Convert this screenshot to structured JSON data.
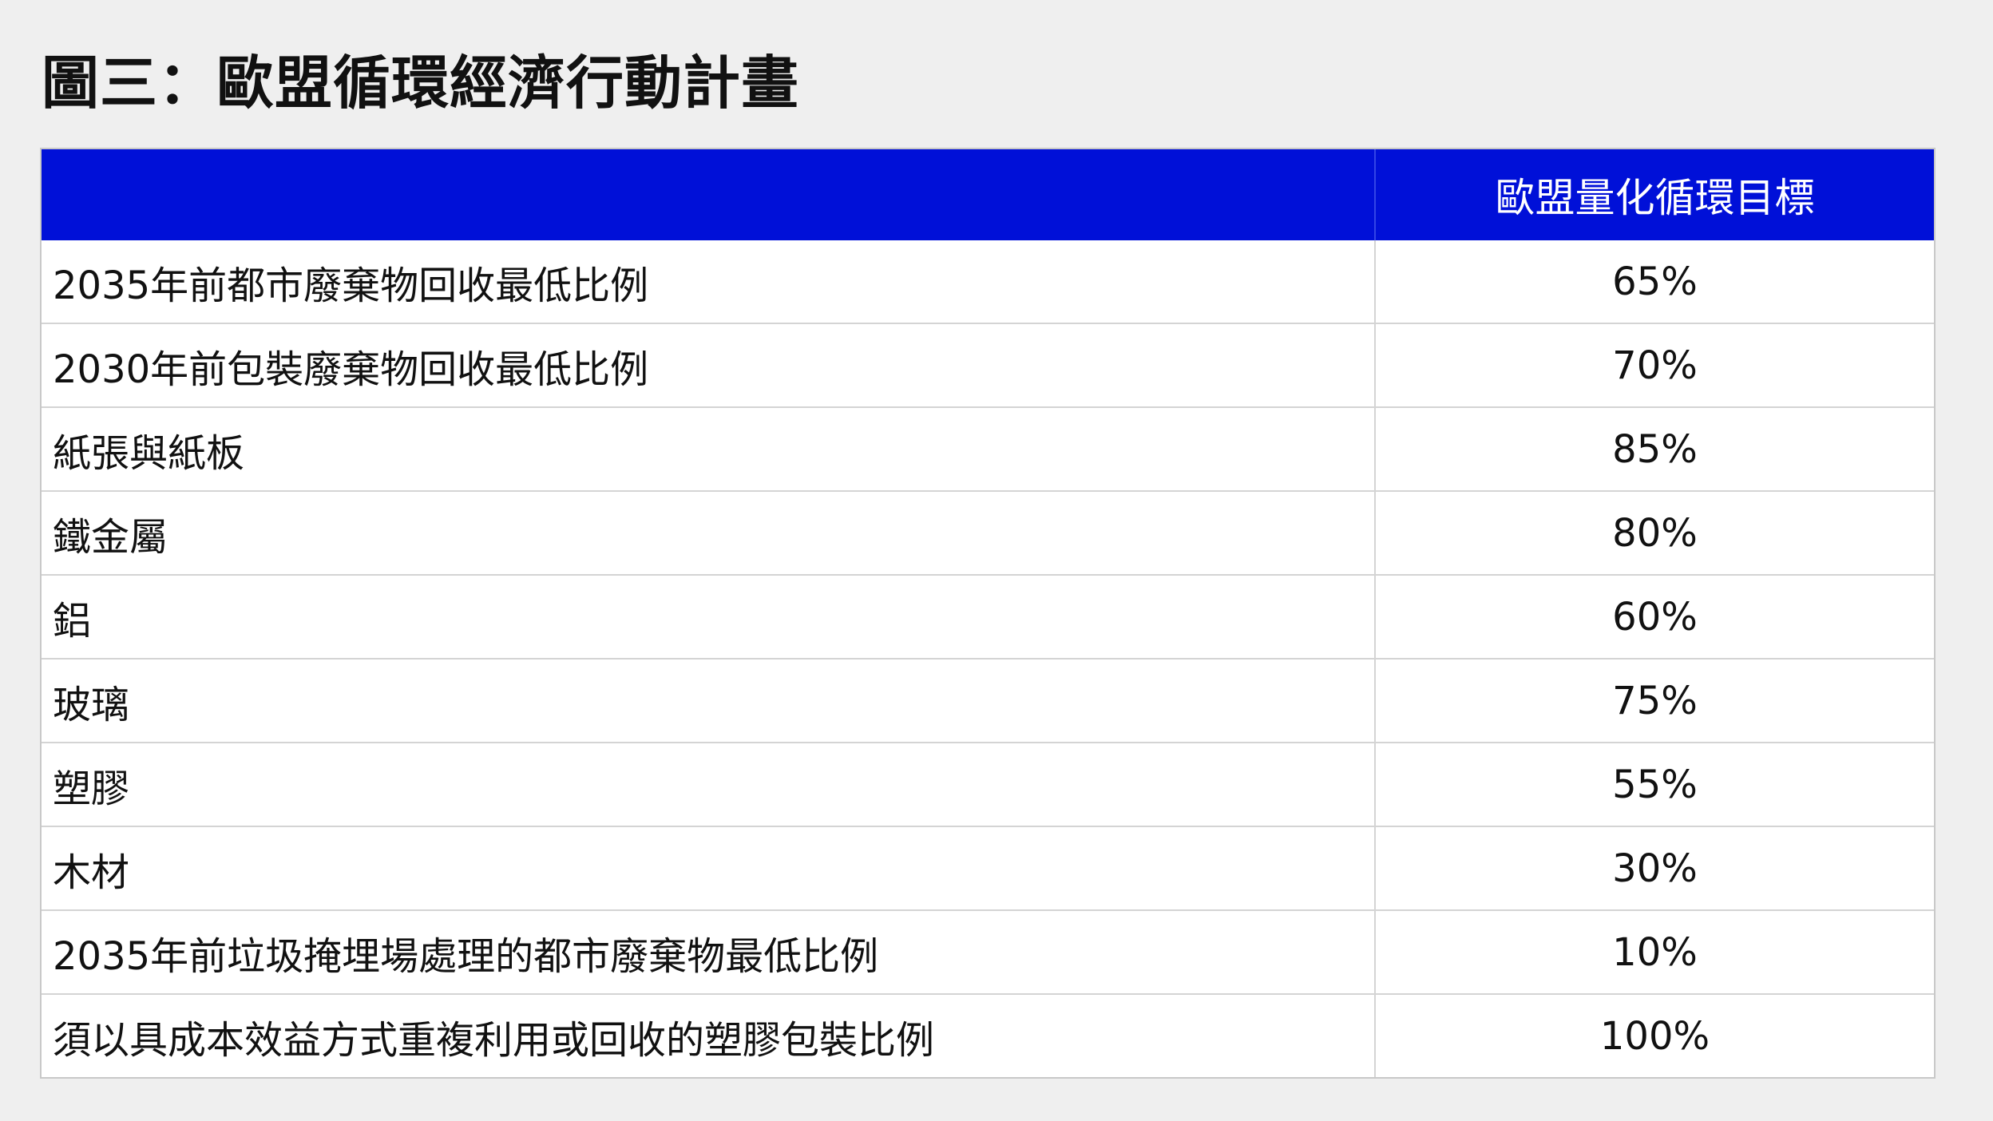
{
  "title": "圖三：歐盟循環經濟行動計畫",
  "colors": {
    "header_bg": "#0010d8",
    "header_text": "#ffffff",
    "page_bg": "#efefef"
  },
  "table": {
    "headers": [
      "",
      "歐盟量化循環目標"
    ],
    "rows": [
      {
        "label": "2035年前都市廢棄物回收最低比例",
        "value": "65%"
      },
      {
        "label": "2030年前包裝廢棄物回收最低比例",
        "value": "70%"
      },
      {
        "label": "紙張與紙板",
        "value": "85%"
      },
      {
        "label": "鐵金屬",
        "value": "80%"
      },
      {
        "label": "鋁",
        "value": "60%"
      },
      {
        "label": "玻璃",
        "value": "75%"
      },
      {
        "label": "塑膠",
        "value": "55%"
      },
      {
        "label": "木材",
        "value": "30%"
      },
      {
        "label": "2035年前垃圾掩埋場處理的都市廢棄物最低比例",
        "value": "10%"
      },
      {
        "label": "須以具成本效益方式重複利用或回收的塑膠包裝比例",
        "value": "100%"
      }
    ]
  }
}
